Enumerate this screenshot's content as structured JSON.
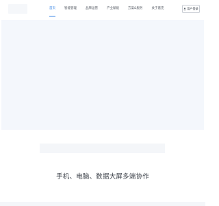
{
  "header": {
    "nav": [
      {
        "label": "首页",
        "active": true
      },
      {
        "label": "智能管理"
      },
      {
        "label": "品牌运营"
      },
      {
        "label": "产业赋能"
      },
      {
        "label": "方案&服务"
      },
      {
        "label": "关于嘉克"
      }
    ],
    "user_button": {
      "label": "用户登录",
      "icon": "user-icon"
    }
  },
  "main": {
    "section_title": "手机、电脑、数据大屏多端协作"
  },
  "colors": {
    "accent": "#2f7fe4",
    "banner_bg": "#f4f7fc"
  }
}
